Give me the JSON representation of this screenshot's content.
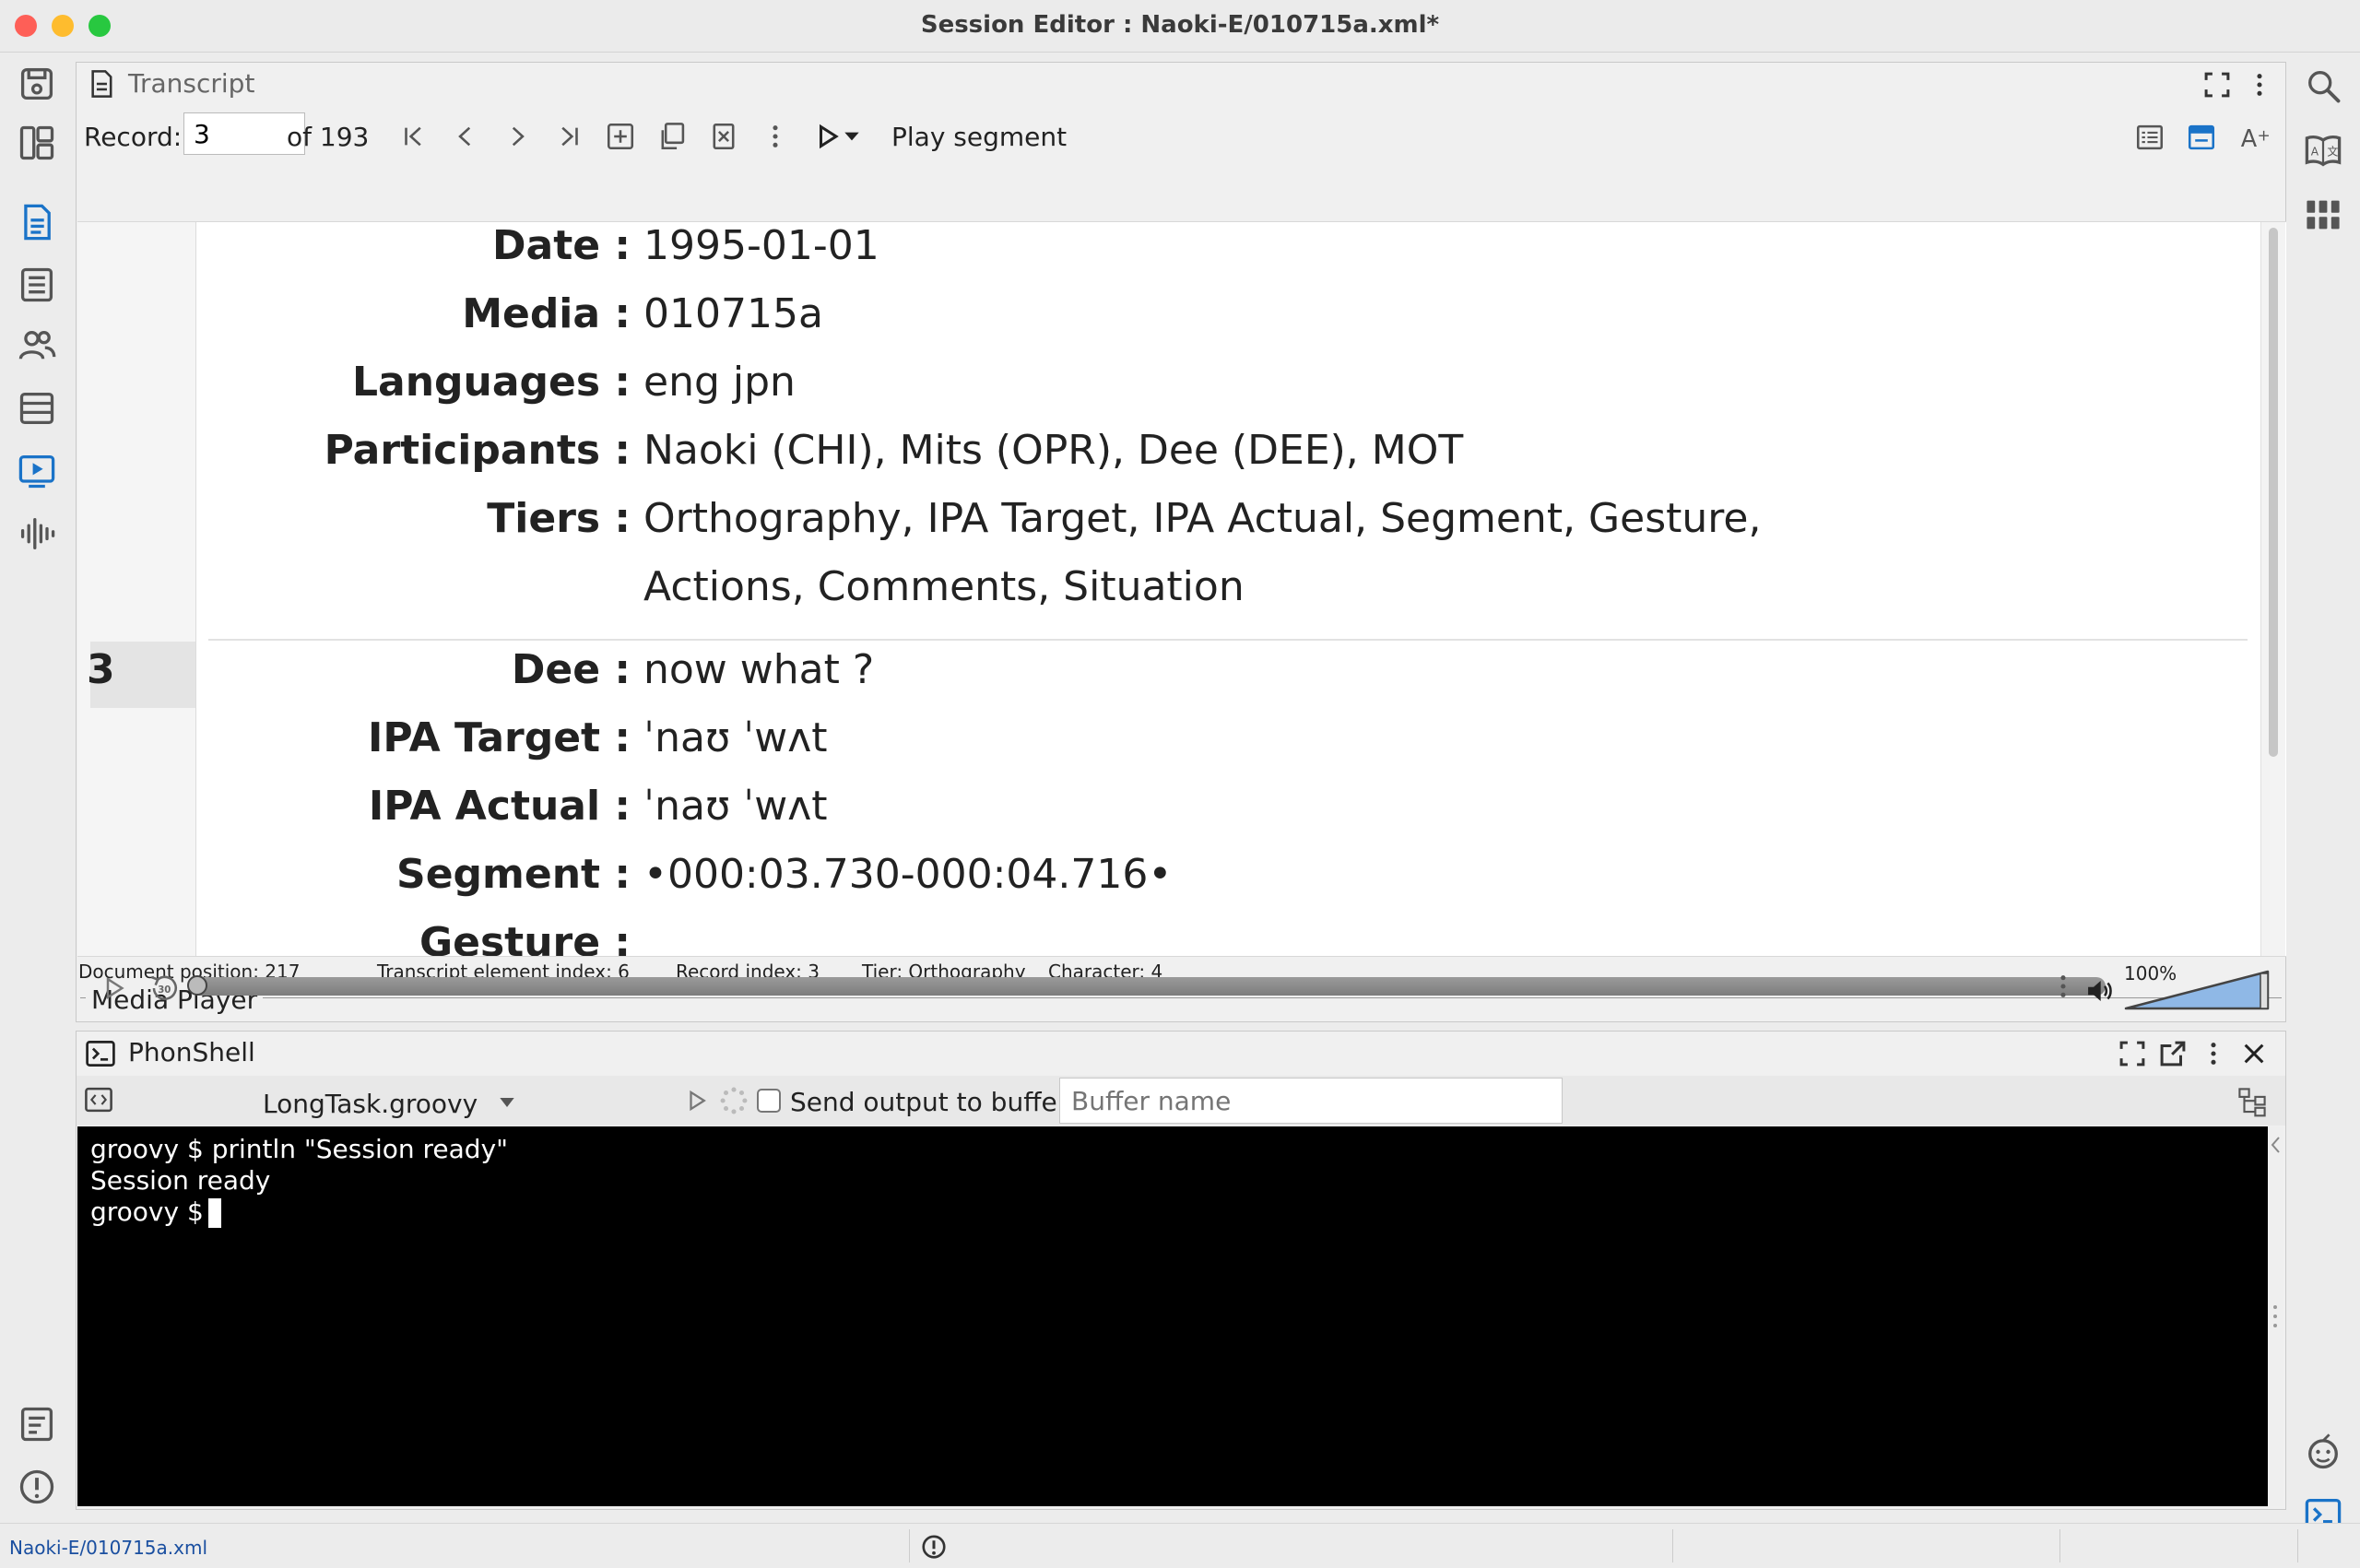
{
  "window": {
    "title": "Session Editor : Naoki-E/010715a.xml*",
    "traffic_colors": [
      "#fe5f57",
      "#febc2e",
      "#28c840"
    ]
  },
  "left_toolbar": {
    "top_icons": [
      "save-icon",
      "layout-icon",
      "transcript-view-icon",
      "record-list-icon",
      "participants-icon",
      "table-icon",
      "media-player-icon",
      "waveform-icon"
    ],
    "bottom_icons": [
      "log-icon",
      "alert-icon"
    ]
  },
  "right_toolbar": {
    "top_icons": [
      "search-icon",
      "dictionary-icon",
      "grid-icon"
    ],
    "bottom_icons": [
      "assistant-icon",
      "phonshell-icon"
    ]
  },
  "transcript": {
    "title": "Transcript",
    "record_label": "Record:",
    "record_value": "3",
    "record_of": "of 193",
    "play_segment": "Play segment",
    "header_rows": [
      {
        "label": "Date :",
        "value": "1995-01-01"
      },
      {
        "label": "Media :",
        "value": "010715a"
      },
      {
        "label": "Languages :",
        "value": "eng jpn"
      },
      {
        "label": "Participants :",
        "value": "Naoki (CHI), Mits (OPR), Dee (DEE), MOT"
      },
      {
        "label": "Tiers :",
        "value": "Orthography, IPA Target, IPA Actual, Segment, Gesture,"
      },
      {
        "label": "",
        "value": "Actions, Comments, Situation"
      }
    ],
    "record_number": "3",
    "record_rows": [
      {
        "label": "Dee :",
        "value": "now what ?"
      },
      {
        "label": "IPA Target :",
        "value": "ˈnaʊ ˈwʌt"
      },
      {
        "label": "IPA Actual :",
        "value": "ˈnaʊ ˈwʌt"
      },
      {
        "label": "Segment :",
        "value": "•000:03.730-000:04.716•"
      },
      {
        "label": "Gesture :",
        "value": ""
      }
    ],
    "status": {
      "document_position": "Document position: 217",
      "element_index": "Transcript element index: 6",
      "record_index": "Record index: 3",
      "tier": "Tier: Orthography",
      "character": "Character: 4"
    }
  },
  "media_player": {
    "title": "Media Player",
    "progress": 0.0,
    "volume_label": "100%",
    "volume": 1.0
  },
  "phonshell": {
    "title": "PhonShell",
    "script_name": "LongTask.groovy",
    "send_output_label": "Send output to buffer",
    "send_output_checked": false,
    "buffer_placeholder": "Buffer name",
    "lines": [
      "groovy $ println \"Session ready\"",
      "Session ready",
      "groovy $ "
    ]
  },
  "statusbar": {
    "path": "Naoki-E/010715a.xml"
  },
  "colors": {
    "accent": "#1a73c8",
    "terminal_bg": "#000000",
    "panel_bg": "#f0f0f0"
  }
}
